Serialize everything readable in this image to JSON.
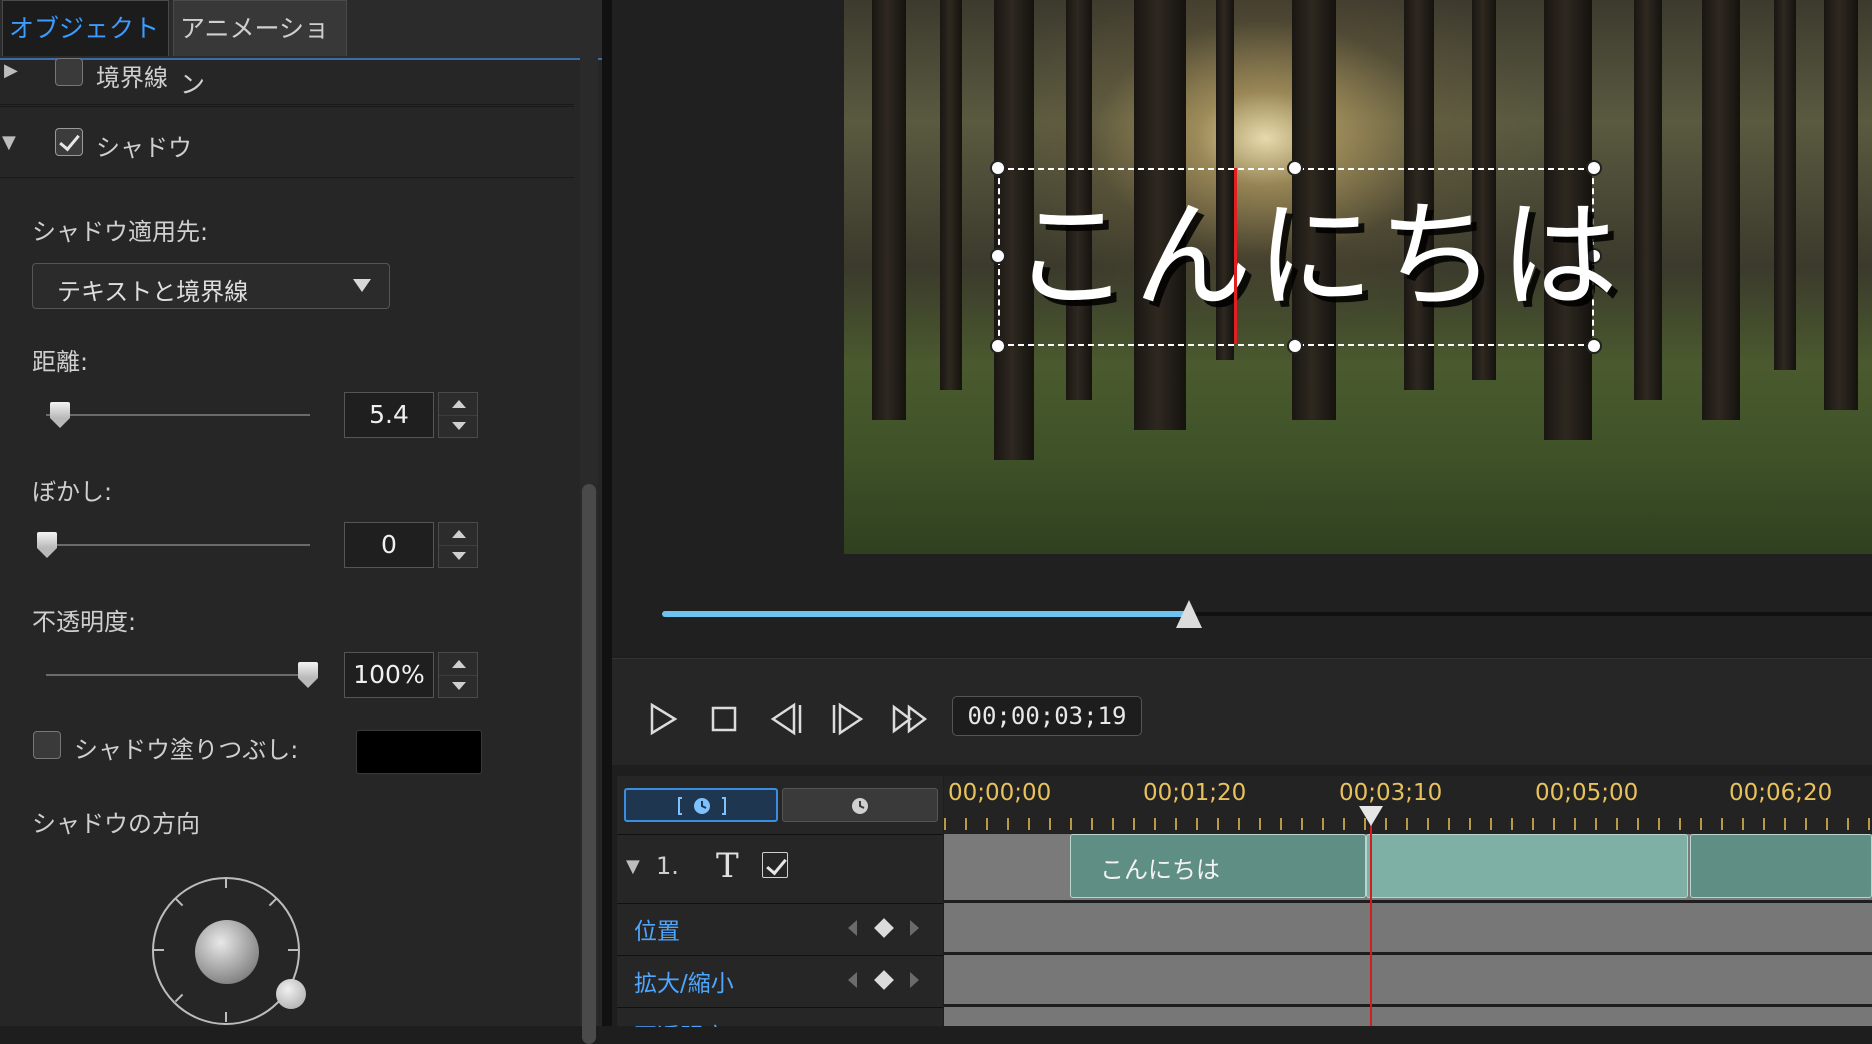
{
  "tabs": {
    "object": "オブジェクト",
    "animation": "アニメーション"
  },
  "sections": {
    "border": {
      "label": "境界線",
      "checked": false
    },
    "shadow": {
      "label": "シャドウ",
      "checked": true
    }
  },
  "shadow": {
    "apply_to_label": "シャドウ適用先:",
    "apply_to_value": "テキストと境界線",
    "distance_label": "距離:",
    "distance_value": "5.4",
    "distance_slider_fraction": 0.05,
    "blur_label": "ぼかし:",
    "blur_value": "0",
    "blur_slider_fraction": 0.0,
    "opacity_label": "不透明度:",
    "opacity_value": "100%",
    "opacity_slider_fraction": 1.0,
    "fill_label": "シャドウ塗りつぶし:",
    "fill_checked": false,
    "fill_color": "#000000",
    "direction_label": "シャドウの方向"
  },
  "preview": {
    "overlay_text": "こんにちは",
    "scrub_fraction": 0.36,
    "scrub_color": "#6cc4ef"
  },
  "transport": {
    "timecode": "00;00;03;19",
    "play_icon": "play-icon",
    "stop_icon": "stop-icon",
    "prev_frame_icon": "previous-frame-icon",
    "next_frame_icon": "next-frame-icon",
    "fast_forward_icon": "fast-forward-icon"
  },
  "timeline": {
    "ruler": [
      "00;00;00",
      "00;01;20",
      "00;03;10",
      "00;05;00",
      "00;06;20"
    ],
    "track": {
      "number": "1.",
      "type_icon": "T",
      "clip_label": "こんにちは"
    },
    "properties": [
      "位置",
      "拡大/縮小",
      "不透明度"
    ]
  },
  "colors": {
    "accent": "#3d9bff",
    "timecode_ruler": "#e8c25a",
    "playhead": "#d11f1f",
    "clip": "#5f8f84"
  }
}
